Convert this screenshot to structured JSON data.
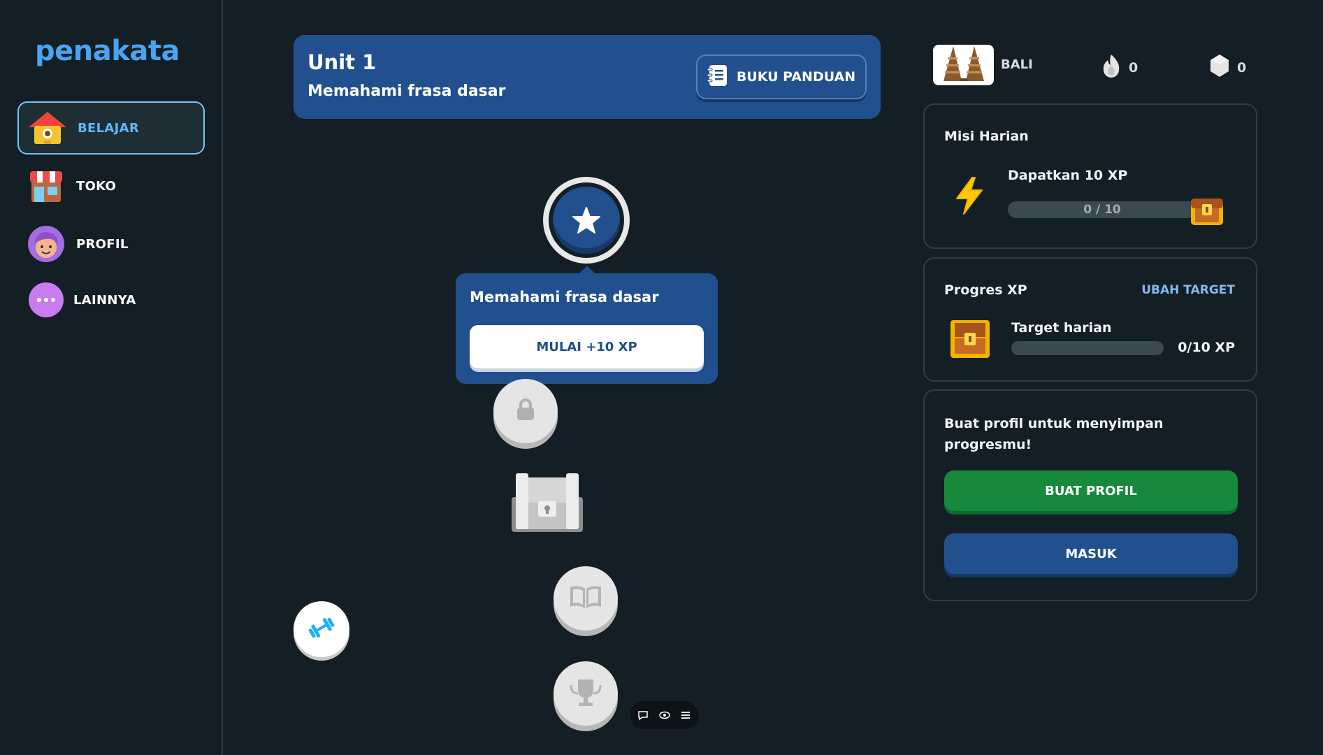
{
  "app": {
    "logo": "penakata"
  },
  "sidebar": {
    "items": [
      {
        "label": "BELAJAR",
        "icon": "house-icon",
        "active": true
      },
      {
        "label": "TOKO",
        "icon": "shop-icon",
        "active": false
      },
      {
        "label": "PROFIL",
        "icon": "avatar-icon",
        "active": false
      },
      {
        "label": "LAINNYA",
        "icon": "more-icon",
        "active": false
      }
    ]
  },
  "unit": {
    "title": "Unit 1",
    "subtitle": "Memahami frasa dasar",
    "guide_label": "BUKU PANDUAN"
  },
  "lesson_popover": {
    "title": "Memahami frasa dasar",
    "start_label": "MULAI +10 XP"
  },
  "path_nodes": [
    {
      "type": "star",
      "state": "current",
      "icon": "star-icon"
    },
    {
      "type": "lesson",
      "state": "locked",
      "icon": "lock-icon"
    },
    {
      "type": "chest",
      "state": "locked",
      "icon": "treasure-chest-icon"
    },
    {
      "type": "story",
      "state": "locked",
      "icon": "book-icon"
    },
    {
      "type": "trophy",
      "state": "locked",
      "icon": "trophy-icon"
    }
  ],
  "stats": {
    "course": "BALI",
    "streak": "0",
    "gems": "0"
  },
  "daily_quests": {
    "title": "Misi Harian",
    "quest_label": "Dapatkan 10 XP",
    "progress_text": "0 / 10",
    "progress": 0
  },
  "xp_progress": {
    "title": "Progres XP",
    "edit_label": "UBAH TARGET",
    "target_label": "Target harian",
    "value_text": "0/10 XP",
    "progress": 0
  },
  "profile_prompt": {
    "text": "Buat profil untuk menyimpan progresmu!",
    "create_label": "BUAT PROFIL",
    "login_label": "MASUK"
  },
  "colors": {
    "background": "#131f24",
    "accent_blue": "#22508f",
    "logo_blue": "#49a4f3",
    "green": "#18893c",
    "link_blue": "#8ab8f0"
  }
}
